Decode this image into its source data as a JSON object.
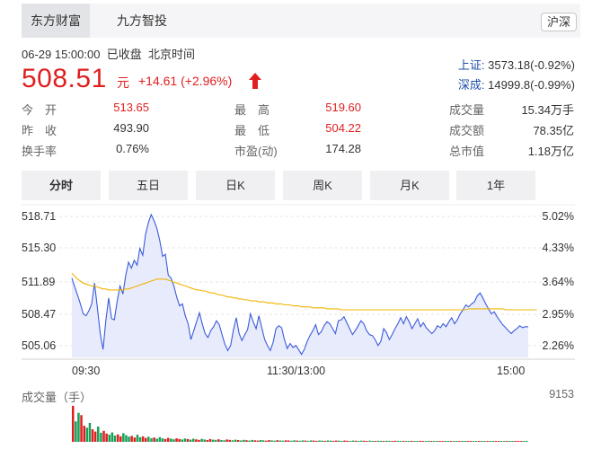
{
  "source_tabs": [
    {
      "label": "东方财富",
      "active": true
    },
    {
      "label": "九方智投",
      "active": false
    }
  ],
  "market_badge": "沪深",
  "header": {
    "datetime": "06-29 15:00:00",
    "status": "已收盘",
    "timezone": "北京时间",
    "price": "508.51",
    "unit": "元",
    "change": "+14.61 (+2.96%)"
  },
  "indexes": [
    {
      "label": "上证:",
      "value": "3573.18(-0.92%)"
    },
    {
      "label": "深成:",
      "value": "14999.8(-0.99%)"
    }
  ],
  "stats": [
    [
      {
        "label": "今　开",
        "value": "513.65",
        "color": "red"
      },
      {
        "label": "最　高",
        "value": "519.60",
        "color": "red"
      },
      {
        "label": "成交量",
        "value": "15.34万手",
        "color": "dark"
      }
    ],
    [
      {
        "label": "昨　收",
        "value": "493.90",
        "color": "dark"
      },
      {
        "label": "最　低",
        "value": "504.22",
        "color": "red"
      },
      {
        "label": "成交额",
        "value": "78.35亿",
        "color": "dark"
      }
    ],
    [
      {
        "label": "换手率",
        "value": "0.76%",
        "color": "dark"
      },
      {
        "label": "市盈(动)",
        "value": "174.28",
        "color": "dark"
      },
      {
        "label": "总市值",
        "value": "1.18万亿",
        "color": "dark"
      }
    ]
  ],
  "period_tabs": [
    {
      "label": "分时",
      "active": true
    },
    {
      "label": "五日",
      "active": false
    },
    {
      "label": "日K",
      "active": false
    },
    {
      "label": "周K",
      "active": false
    },
    {
      "label": "月K",
      "active": false
    },
    {
      "label": "1年",
      "active": false
    }
  ],
  "colors": {
    "price_line": "#3b5bdb",
    "avg_line": "#f0b400",
    "area_fill": "#e8ebfb",
    "up": "#e02020",
    "down": "#18a058",
    "accent_blue": "#1f4ea8"
  },
  "chart_data": {
    "type": "line",
    "y_ticks_left": [
      "518.71",
      "515.30",
      "511.89",
      "508.47",
      "505.06"
    ],
    "y_ticks_right": [
      "5.02%",
      "4.33%",
      "3.64%",
      "2.95%",
      "2.26%"
    ],
    "ylim": [
      505.06,
      518.71
    ],
    "x_ticks": [
      "09:30",
      "11:30/13:00",
      "15:00"
    ],
    "series": [
      {
        "values": [
          512.2,
          511.3,
          510.5,
          509.6,
          508.6,
          508.4,
          508.9,
          509.6,
          511.7,
          509.2,
          506.6,
          505.0,
          508.0,
          510.2,
          508.1,
          508.0,
          509.9,
          511.4,
          510.6,
          512.5,
          513.8,
          513.2,
          514.0,
          513.5,
          515.2,
          514.5,
          516.6,
          517.8,
          518.6,
          518.0,
          517.2,
          516.0,
          514.4,
          514.6,
          512.5,
          512.2,
          511.4,
          510.3,
          509.4,
          509.6,
          508.4,
          507.6,
          506.0,
          506.9,
          507.8,
          508.7,
          507.6,
          506.6,
          506.2,
          506.9,
          507.3,
          507.9,
          507.5,
          506.5,
          505.5,
          504.9,
          505.4,
          507.0,
          508.2,
          506.6,
          505.9,
          506.5,
          507.0,
          508.6,
          507.8,
          507.1,
          508.4,
          507.2,
          506.0,
          505.4,
          504.9,
          505.7,
          507.1,
          507.4,
          507.2,
          506.0,
          505.1,
          505.6,
          505.2,
          505.4,
          505.0,
          504.5,
          505.0,
          505.8,
          506.4,
          506.9,
          507.5,
          506.5,
          506.8,
          507.4,
          507.8,
          507.6,
          507.1,
          506.6,
          507.9,
          508.0,
          508.3,
          507.7,
          507.1,
          506.5,
          506.9,
          507.4,
          507.9,
          507.6,
          506.9,
          506.5,
          506.4,
          506.0,
          505.4,
          505.8,
          507.1,
          506.7,
          506.0,
          506.5,
          507.1,
          507.6,
          508.2,
          507.6,
          508.3,
          507.8,
          507.1,
          507.6,
          508.1,
          507.3,
          507.7,
          507.2,
          506.9,
          506.6,
          506.9,
          507.4,
          507.2,
          507.6,
          507.3,
          507.8,
          508.2,
          507.6,
          508.0,
          508.6,
          509.0,
          509.5,
          509.3,
          509.6,
          509.8,
          510.4,
          510.7,
          510.2,
          509.6,
          509.1,
          508.6,
          508.8,
          508.3,
          507.9,
          507.5,
          507.2,
          506.9,
          506.6,
          506.9,
          507.1,
          507.4,
          507.2,
          507.3,
          507.3
        ],
        "color_key": "price_line"
      },
      {
        "values": [
          512.7,
          512.4,
          512.1,
          511.9,
          511.7,
          511.6,
          511.5,
          511.4,
          511.4,
          511.3,
          511.2,
          511.1,
          511.1,
          511.0,
          511.0,
          511.0,
          511.0,
          511.0,
          511.0,
          511.1,
          511.1,
          511.2,
          511.3,
          511.4,
          511.5,
          511.6,
          511.7,
          511.8,
          511.9,
          512.0,
          512.1,
          512.1,
          512.1,
          512.1,
          512.0,
          511.9,
          511.8,
          511.7,
          511.6,
          511.5,
          511.4,
          511.3,
          511.2,
          511.1,
          511.0,
          511.0,
          510.9,
          510.9,
          510.8,
          510.7,
          510.7,
          510.6,
          510.5,
          510.5,
          510.4,
          510.3,
          510.3,
          510.2,
          510.2,
          510.1,
          510.1,
          510.0,
          510.0,
          509.9,
          509.9,
          509.9,
          509.8,
          509.8,
          509.8,
          509.7,
          509.7,
          509.7,
          509.6,
          509.6,
          509.6,
          509.5,
          509.5,
          509.5,
          509.4,
          509.4,
          509.4,
          509.3,
          509.3,
          509.3,
          509.3,
          509.2,
          509.2,
          509.2,
          509.2,
          509.2,
          509.1,
          509.1,
          509.1,
          509.1,
          509.1,
          509.0,
          509.0,
          509.0,
          509.0,
          509.0,
          509.0,
          509.0,
          509.0,
          509.0,
          509.0,
          509.0,
          509.0,
          509.0,
          509.0,
          509.0,
          509.0,
          509.0,
          509.0,
          509.0,
          509.0,
          509.0,
          509.0,
          509.0,
          509.0,
          509.0,
          509.0,
          509.0,
          509.0,
          509.0,
          509.0,
          509.0,
          509.0,
          509.0,
          509.0,
          509.0,
          509.0,
          509.0,
          509.0,
          509.0,
          509.0,
          509.0,
          509.0,
          509.0,
          509.0,
          509.0,
          509.1,
          509.1,
          509.1,
          509.1,
          509.1,
          509.1,
          509.1,
          509.1,
          509.1,
          509.1,
          509.1,
          509.1,
          509.1,
          509.0,
          509.0,
          509.0,
          509.0,
          509.0,
          509.0,
          509.0,
          509.0,
          509.0,
          509.0,
          509.0,
          509.0
        ],
        "color_key": "avg_line"
      }
    ]
  },
  "volume": {
    "label": "成交量（手）",
    "max_label": "9153",
    "max": 9153,
    "bars": [
      9153,
      5200,
      7400,
      6800,
      4100,
      3600,
      4800,
      3200,
      2600,
      3900,
      2300,
      2800,
      2100,
      1800,
      2400,
      1600,
      1900,
      1400,
      2200,
      1700,
      1300,
      1500,
      1100,
      1800,
      1200,
      1400,
      1000,
      1300,
      900,
      1100,
      800,
      1200,
      900,
      700,
      1000,
      800,
      650,
      900,
      700,
      600,
      850,
      700,
      550,
      800,
      650,
      500,
      750,
      600,
      450,
      700,
      550,
      500,
      650,
      450,
      400,
      600,
      500,
      380,
      550,
      450,
      350,
      500,
      420,
      330,
      480,
      400,
      320,
      460,
      380,
      300,
      440,
      360,
      300,
      420,
      350,
      290,
      400,
      340,
      280,
      380,
      330,
      270,
      370,
      320,
      260,
      360,
      310,
      260,
      350,
      300,
      250,
      340,
      300,
      250,
      330,
      290,
      240,
      320,
      280,
      240,
      310,
      280,
      230,
      300,
      270,
      230,
      290,
      260,
      220,
      280,
      260,
      220,
      280,
      250,
      220,
      270,
      250,
      210,
      260,
      240,
      210,
      260,
      240,
      200,
      250,
      230,
      200,
      250,
      230,
      200,
      240,
      220,
      200,
      240,
      220,
      190,
      230,
      220,
      190,
      230,
      210,
      190,
      220,
      210,
      180,
      220,
      210,
      180,
      220,
      200,
      180,
      210,
      200,
      170,
      210,
      200,
      170,
      200,
      190,
      170,
      200,
      190,
      260
    ],
    "dirs": "udduudduudduuddduuddduudduudduddduudduuddudduudduuddudduudduddudduudduuddudduudduddudduuddudduudduuddudduudduddudduudduddudduuddudduudduddudduudduddudduuddudduu"
  }
}
